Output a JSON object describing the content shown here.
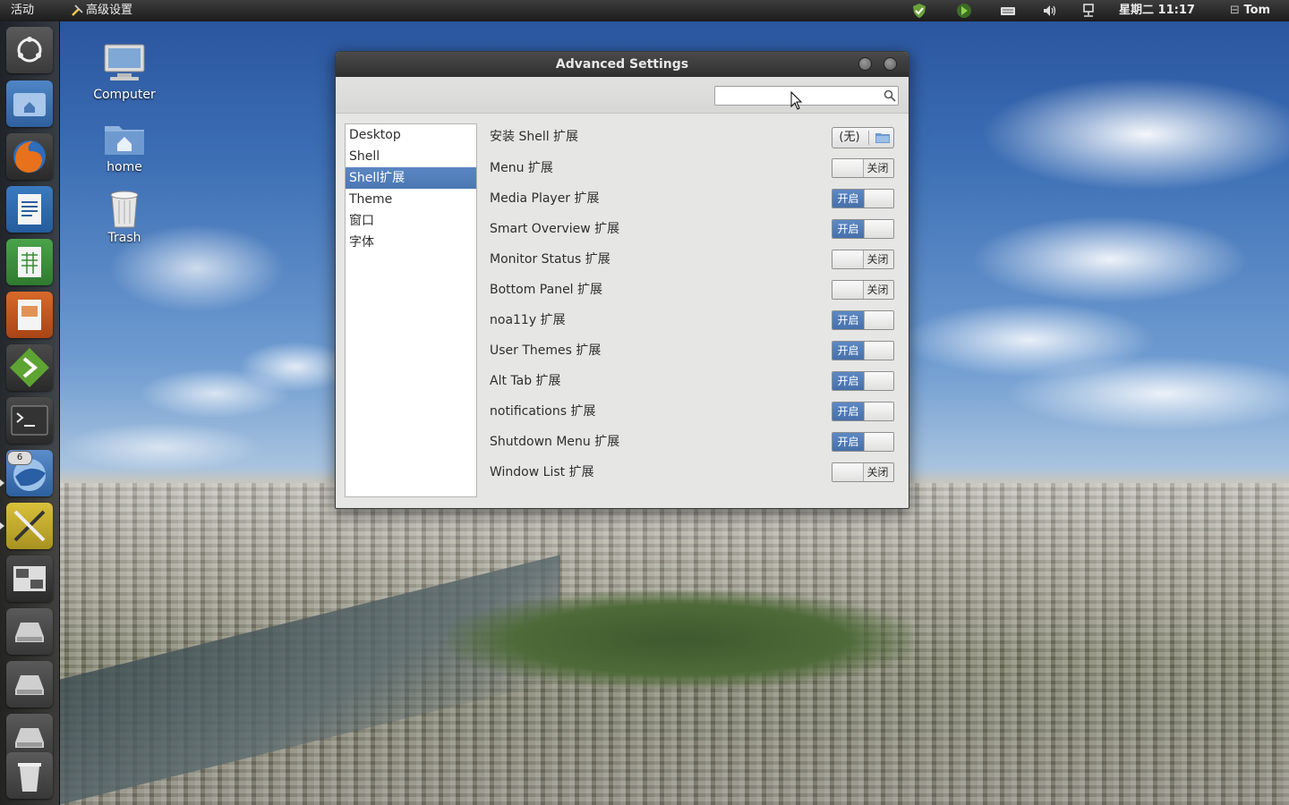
{
  "top_panel": {
    "activities": "活动",
    "app_menu": "高级设置",
    "clock": "星期二 11:17",
    "user": "Tom"
  },
  "launcher": {
    "items": [
      "ubuntu-logo",
      "home-folder",
      "firefox",
      "writer",
      "calc",
      "impress",
      "gedit",
      "terminal",
      "thunderbird",
      "tweak-tool",
      "workspace-switcher",
      "drive",
      "drive",
      "drive",
      "trash"
    ],
    "badge_count": "6"
  },
  "desktop": {
    "icons": [
      {
        "label": "Computer"
      },
      {
        "label": "home"
      },
      {
        "label": "Trash"
      }
    ]
  },
  "dialog": {
    "title": "Advanced Settings",
    "search": {
      "value": "",
      "placeholder": ""
    },
    "categories": [
      {
        "label": "Desktop",
        "selected": false
      },
      {
        "label": "Shell",
        "selected": false
      },
      {
        "label": "Shell扩展",
        "selected": true
      },
      {
        "label": "Theme",
        "selected": false
      },
      {
        "label": "窗口",
        "selected": false
      },
      {
        "label": "字体",
        "selected": false
      }
    ],
    "install": {
      "label": "安装 Shell 扩展",
      "value": "(无)"
    },
    "on_label": "开启",
    "off_label": "关闭",
    "extensions": [
      {
        "label": "Menu 扩展",
        "enabled": false
      },
      {
        "label": "Media Player 扩展",
        "enabled": true
      },
      {
        "label": "Smart Overview 扩展",
        "enabled": true
      },
      {
        "label": "Monitor Status 扩展",
        "enabled": false
      },
      {
        "label": "Bottom Panel 扩展",
        "enabled": false
      },
      {
        "label": "noa11y 扩展",
        "enabled": true
      },
      {
        "label": "User Themes 扩展",
        "enabled": true
      },
      {
        "label": "Alt Tab 扩展",
        "enabled": true
      },
      {
        "label": "notifications 扩展",
        "enabled": true
      },
      {
        "label": "Shutdown Menu 扩展",
        "enabled": true
      },
      {
        "label": "Window List 扩展",
        "enabled": false
      }
    ]
  },
  "colors": {
    "accent": "#4b77b4",
    "panel": "#2a2a2a",
    "dialog_bg": "#e6e6e5"
  }
}
